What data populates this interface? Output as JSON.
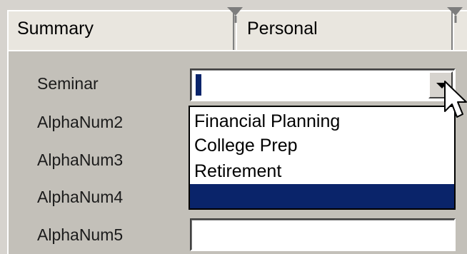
{
  "tabs": [
    {
      "label": "Summary"
    },
    {
      "label": "Personal"
    }
  ],
  "form": {
    "labels": [
      "Seminar",
      "AlphaNum2",
      "AlphaNum3",
      "AlphaNum4",
      "AlphaNum5"
    ],
    "seminar": {
      "value": "",
      "options": [
        "Financial Planning",
        "College Prep",
        "Retirement",
        ""
      ]
    },
    "alphanum5_value": ""
  },
  "colors": {
    "highlight": "#0a246a",
    "panel": "#c3c0b9",
    "tab": "#e9e6df"
  },
  "icons": {
    "dropdown": "chevron-down-icon",
    "cursor": "mouse-pointer-icon"
  }
}
